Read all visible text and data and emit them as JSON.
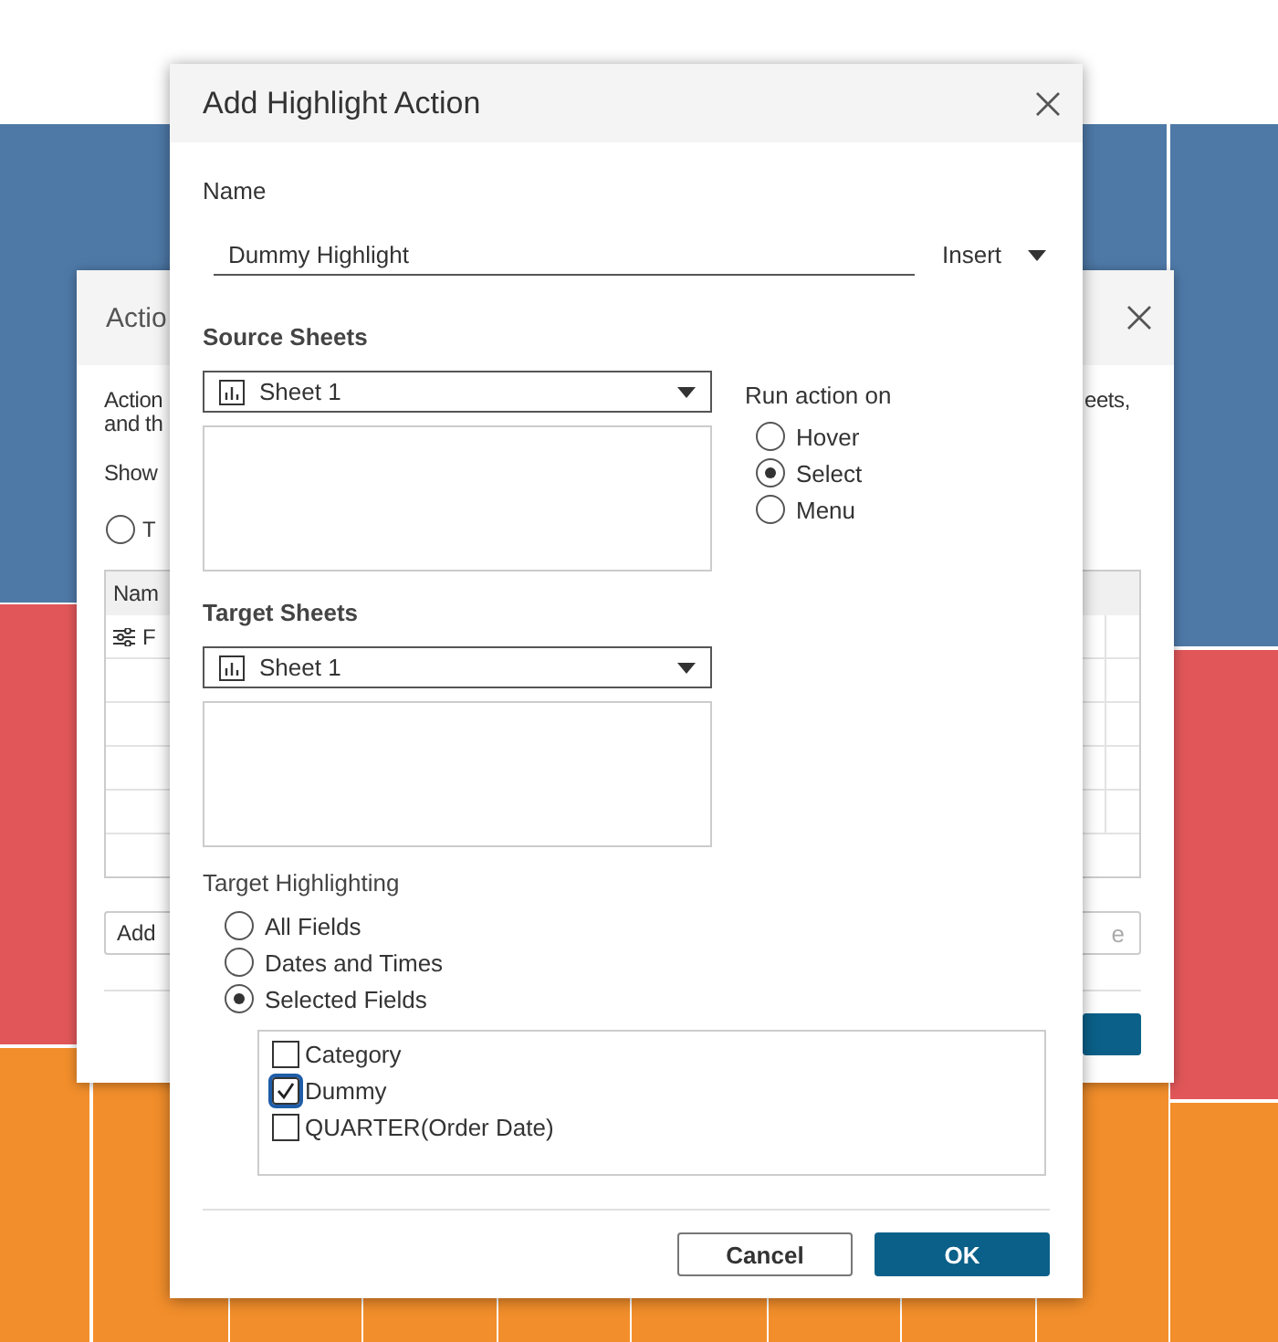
{
  "background_window": {
    "title": "Actio",
    "intro_line_1_start": "Action",
    "intro_line_1_end": "eets,",
    "intro_line_2_start": "and th",
    "show_label": "Show",
    "show_option": {
      "label": "T",
      "selected": false
    },
    "table": {
      "column_1": "Nam",
      "rows": [
        {
          "column_1": "F"
        }
      ]
    },
    "left_button": "Add",
    "right_button": "e"
  },
  "dialog": {
    "title": "Add Highlight Action",
    "name_label": "Name",
    "name_value": "Dummy Highlight",
    "insert_menu": "Insert",
    "source_sheets": {
      "label": "Source Sheets",
      "selection": "Sheet 1"
    },
    "run_action_on": {
      "label": "Run action on",
      "options": [
        {
          "label": "Hover",
          "selected": false
        },
        {
          "label": "Select",
          "selected": true
        },
        {
          "label": "Menu",
          "selected": false
        }
      ]
    },
    "target_sheets": {
      "label": "Target Sheets",
      "selection": "Sheet 1"
    },
    "target_highlighting": {
      "label": "Target Highlighting",
      "options": [
        {
          "label": "All Fields",
          "selected": false
        },
        {
          "label": "Dates and Times",
          "selected": false
        },
        {
          "label": "Selected Fields",
          "selected": true
        }
      ],
      "fields": [
        {
          "label": "Category",
          "checked": false,
          "focused": false
        },
        {
          "label": "Dummy",
          "checked": true,
          "focused": true
        },
        {
          "label": "QUARTER(Order Date)",
          "checked": false,
          "focused": false
        }
      ]
    },
    "buttons": [
      {
        "label": "Cancel",
        "kind": "secondary"
      },
      {
        "label": "OK",
        "kind": "primary"
      }
    ]
  }
}
